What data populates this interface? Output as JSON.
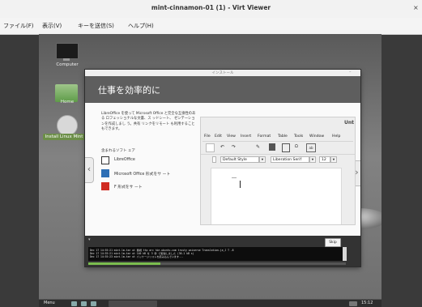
{
  "window": {
    "title": "mint-cinnamon-01 (1) - Virt Viewer",
    "close_glyph": "×"
  },
  "menubar": {
    "items": [
      "ファイル(F)",
      "表示(V)",
      "キーを送信(S)",
      "ヘルプ(H)"
    ]
  },
  "desktop": {
    "icons": {
      "computer": "Computer",
      "home": "Home",
      "installer": "Install Linux Mint"
    }
  },
  "dialog": {
    "title": "インストール",
    "minimize_glyph": "–",
    "slide": {
      "heading": "仕事を効率的に",
      "description": "LibreOffice を使って Microsoft Office と完全な互換性のある ロフェッショナルな文書、ス ッドシート、 ゼンテーションを作成しまし う。共有 リンクをリモート も利用することもできます。",
      "included_heading": "含まれるソフト ェア",
      "software": [
        "LibreOffice",
        "Microsoft Office 形式をサ ート",
        "F 形式をサ ート"
      ],
      "prev_glyph": "‹",
      "next_glyph": "›"
    },
    "preview": {
      "app_label": "Unt",
      "menu": [
        "File",
        "Edit",
        "View",
        "Insert",
        "Format",
        "Table",
        "Tools",
        "Window",
        "Help"
      ],
      "style_value": "Default Style",
      "font_value": "Liberation Serif",
      "size_value": "12"
    },
    "bottom": {
      "collapse_glyph": "▾",
      "skip_label": "Skip",
      "terminal_lines": [
        "Dec 17 14:55:21 mint-lm-tar ut  無視 ttp  arc hie.ubuntu.com trusty universe Translation-ja_J  T -8",
        "Dec 17 14:55:21 mint-lm-tar ut  140 kB を 3 秒 で取得しました (36.1 kB s)",
        "Dec 17 14:55:23 mint-lm-tar ut  パッケージリストを読み込んでいます..."
      ],
      "progress_fraction": 0.28
    }
  },
  "taskbar": {
    "menu_label": "Menu",
    "clock": "15:12"
  }
}
